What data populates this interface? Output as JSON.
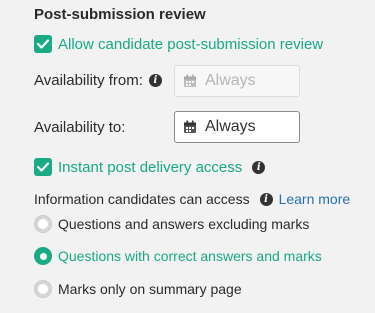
{
  "section": {
    "title": "Post-submission review"
  },
  "allow_review": {
    "label": "Allow candidate post-submission review",
    "checked": true
  },
  "availability_from": {
    "label": "Availability from:",
    "value": "Always",
    "disabled": true
  },
  "availability_to": {
    "label": "Availability to:",
    "value": "Always",
    "disabled": false
  },
  "instant_access": {
    "label": "Instant post delivery access",
    "checked": true
  },
  "info_access": {
    "label": "Information candidates can access",
    "learn_more": "Learn more",
    "options": [
      {
        "label": "Questions and answers excluding marks",
        "selected": false
      },
      {
        "label": "Questions with correct answers and marks",
        "selected": true
      },
      {
        "label": "Marks only on summary page",
        "selected": false
      }
    ]
  },
  "colors": {
    "accent": "#1aaa86",
    "link": "#2a6fb5",
    "panel": "#f2f2f2"
  },
  "icons": {
    "checkbox": "check-icon",
    "info": "info-icon",
    "calendar": "calendar-icon"
  }
}
